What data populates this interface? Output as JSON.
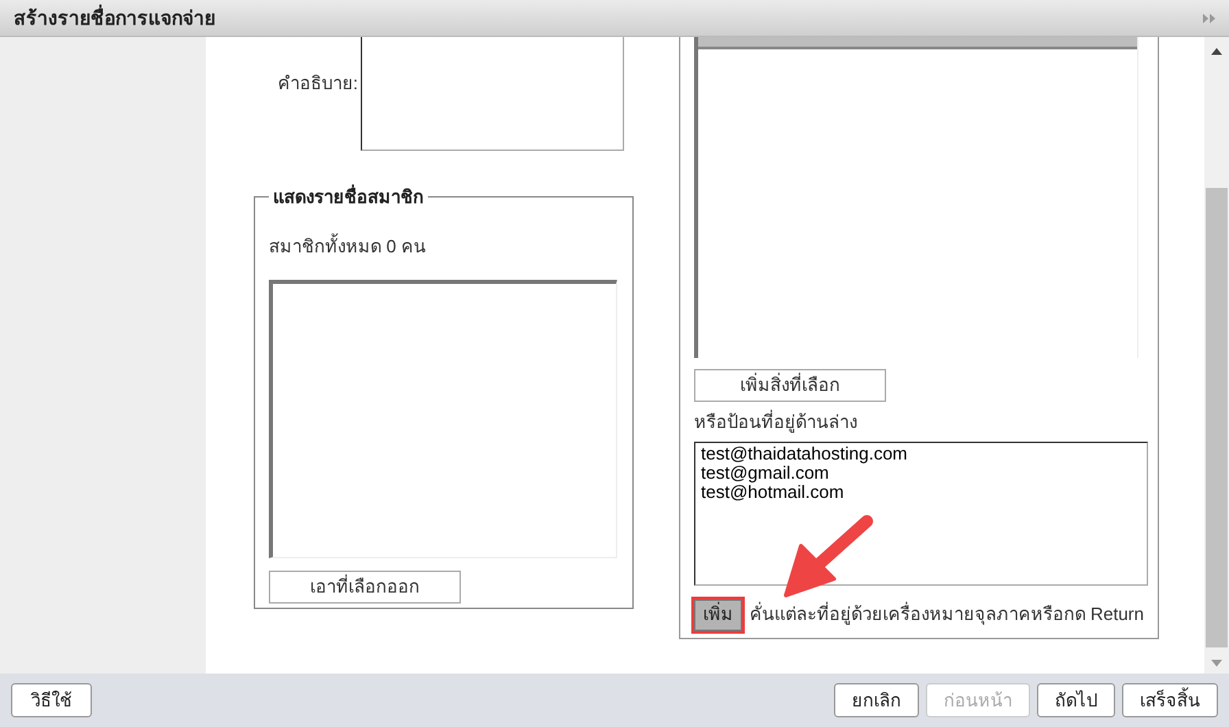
{
  "window": {
    "title": "สร้างรายชื่อการแจกจ่าย"
  },
  "description": {
    "label": "คำอธิบาย:"
  },
  "members": {
    "legend": "แสดงรายชื่อสมาชิก",
    "count": "สมาชิกทั้งหมด 0 คน",
    "remove_button": "เอาที่เลือกออก"
  },
  "add_selected_button": "เพิ่มสิ่งที่เลือก",
  "manual": {
    "label": "หรือป้อนที่อยู่ด้านล่าง",
    "value": "test@thaidatahosting.com\ntest@gmail.com\ntest@hotmail.com",
    "add_button": "เพิ่ม",
    "hint": "คั่นแต่ละที่อยู่ด้วยเครื่องหมายจุลภาคหรือกด Return"
  },
  "footer": {
    "help_button": "วิธีใช้",
    "buttons": [
      {
        "label": "ยกเลิก",
        "disabled": false
      },
      {
        "label": "ก่อนหน้า",
        "disabled": true
      },
      {
        "label": "ถัดไป",
        "disabled": false
      },
      {
        "label": "เสร็จสิ้น",
        "disabled": false
      }
    ]
  }
}
